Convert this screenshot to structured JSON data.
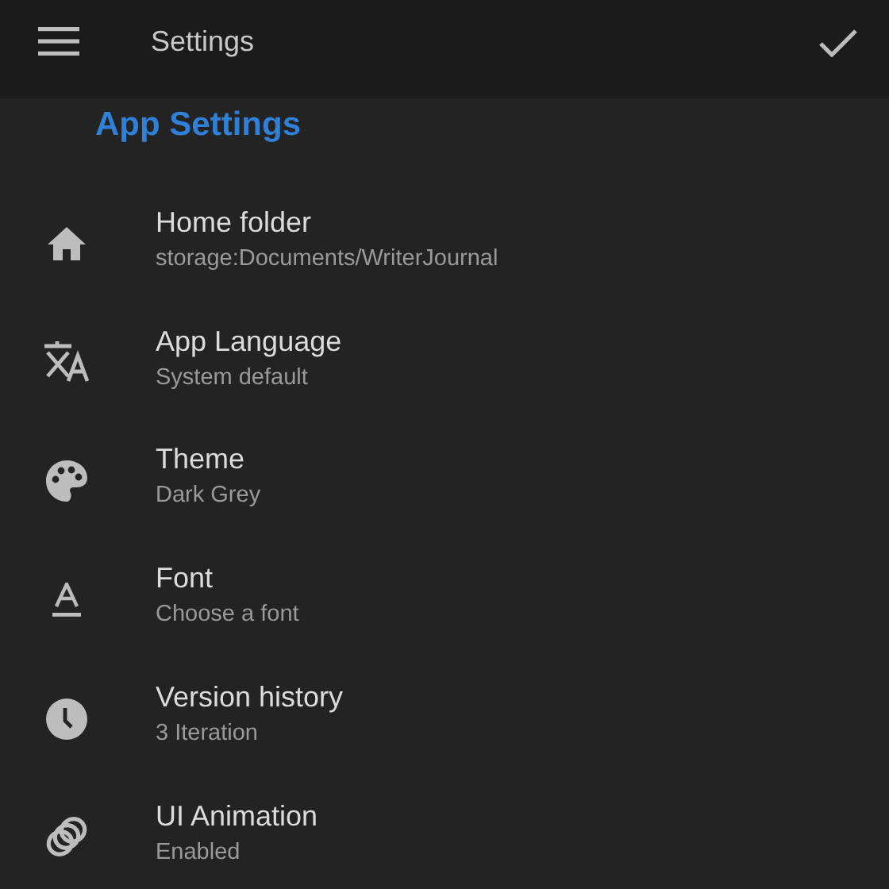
{
  "toolbar": {
    "title": "Settings"
  },
  "section": {
    "title": "App Settings"
  },
  "items": [
    {
      "title": "Home folder",
      "summary": "storage:Documents/WriterJournal"
    },
    {
      "title": "App Language",
      "summary": "System default"
    },
    {
      "title": "Theme",
      "summary": "Dark Grey"
    },
    {
      "title": "Font",
      "summary": "Choose a font"
    },
    {
      "title": "Version history",
      "summary": "3 Iteration"
    },
    {
      "title": "UI Animation",
      "summary": "Enabled"
    }
  ]
}
